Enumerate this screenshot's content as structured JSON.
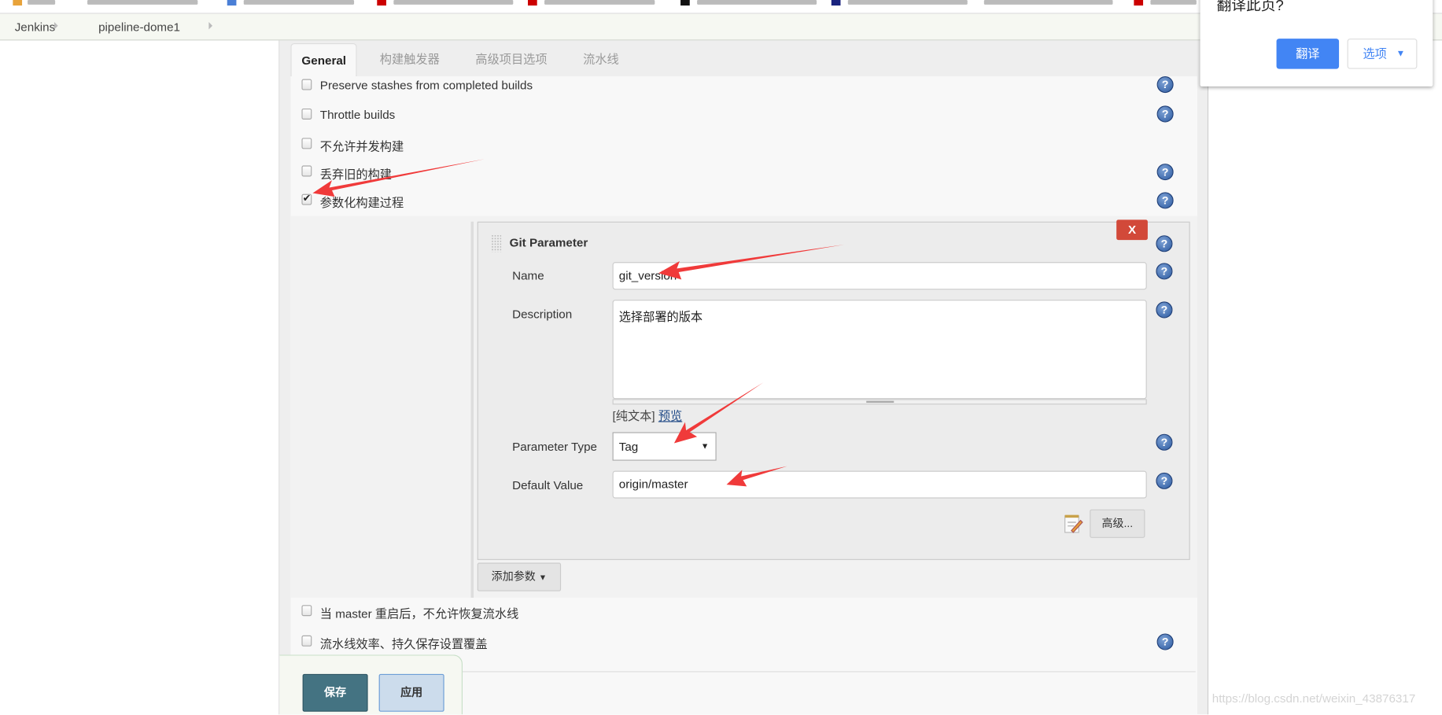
{
  "breadcrumb": {
    "items": [
      "Jenkins",
      "pipeline-dome1"
    ]
  },
  "tabs": [
    {
      "label": "General",
      "active": true
    },
    {
      "label": "构建触发器"
    },
    {
      "label": "高级项目选项"
    },
    {
      "label": "流水线"
    }
  ],
  "options_top": [
    {
      "label": "Preserve stashes from completed builds",
      "checked": false,
      "help": true
    },
    {
      "label": "Throttle builds",
      "checked": false,
      "help": true
    },
    {
      "label": "不允许并发构建",
      "checked": false,
      "help": false
    },
    {
      "label": "丢弃旧的构建",
      "checked": false,
      "help": true
    },
    {
      "label": "参数化构建过程",
      "checked": true,
      "help": true
    }
  ],
  "git_parameter": {
    "title": "Git Parameter",
    "delete_label": "X",
    "name_label": "Name",
    "name_value": "git_version",
    "description_label": "Description",
    "description_value": "选择部署的版本",
    "format_plain": "[纯文本]",
    "format_preview": "预览",
    "type_label": "Parameter Type",
    "type_value": "Tag",
    "default_label": "Default Value",
    "default_value": "origin/master",
    "advanced_label": "高级..."
  },
  "add_param_label": "添加参数",
  "options_bottom": [
    {
      "label": "当 master 重启后，不允许恢复流水线",
      "checked": false,
      "help": false
    },
    {
      "label": "流水线效率、持久保存设置覆盖",
      "checked": false,
      "help": true
    }
  ],
  "footer": {
    "save_label": "保存",
    "apply_label": "应用"
  },
  "translate_popup": {
    "title": "翻译此页?",
    "translate_label": "翻译",
    "options_label": "选项"
  },
  "watermark": "https://blog.csdn.net/weixin_43876317",
  "colors": {
    "save": "#447382",
    "delete": "#d24939",
    "translate": "#4285f4",
    "annotation_arrow": "#f03a3a"
  }
}
